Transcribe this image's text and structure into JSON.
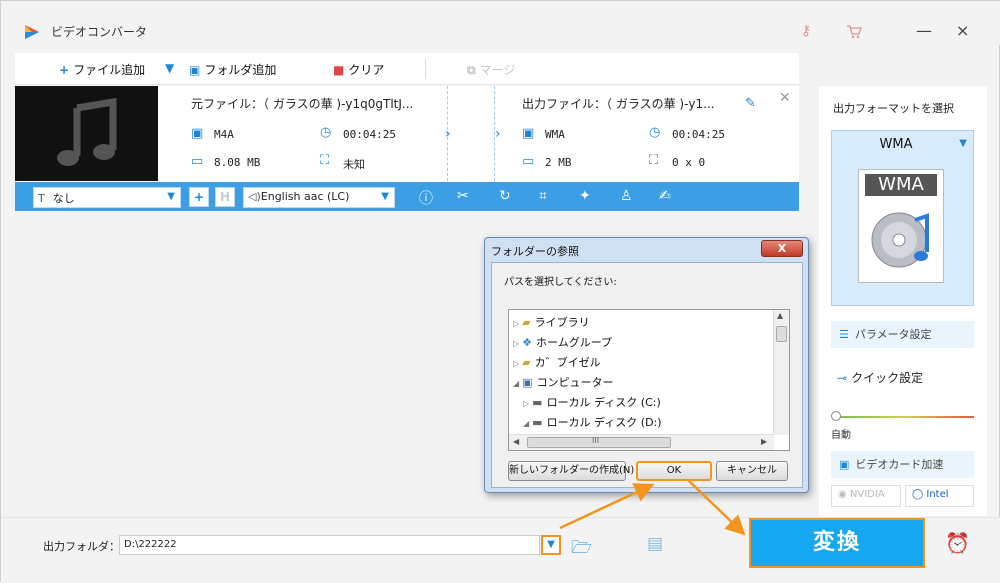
{
  "app": {
    "title": "ビデオコンバータ",
    "accent_color": "#1e86d8",
    "titlebar_icons": [
      "key-icon",
      "cart-icon"
    ],
    "window_controls": {
      "minimize": "—",
      "close": "×"
    }
  },
  "toolbar": {
    "add_file": "ファイル追加",
    "add_folder": "フォルダ追加",
    "clear": "クリア",
    "merge": "マージ"
  },
  "file": {
    "source_name": "元ファイル：（ ガラスの華 )-y1q0gTltJ...",
    "source_format": "M4A",
    "source_duration": "00:04:25",
    "source_size": "8.08 MB",
    "source_resolution": "未知",
    "output_name": "出力ファイル：（ ガラスの華 )-y1...",
    "output_format": "WMA",
    "output_duration": "00:04:25",
    "output_size": "2 MB",
    "output_resolution": "0 x 0"
  },
  "editbar": {
    "subtitle_value": "なし",
    "audio_track": "English aac (LC)",
    "tools": [
      "info-icon",
      "cut-icon",
      "rotate-icon",
      "crop-icon",
      "effect-icon",
      "watermark-icon",
      "subtitle-edit-icon"
    ]
  },
  "right_panel": {
    "title": "出力フォーマットを選択",
    "format": "WMA",
    "format_image_label": "WMA",
    "params": "パラメータ設定",
    "quick": "クイック設定",
    "auto": "自動",
    "gpu": "ビデオカード加速",
    "nvidia": "NVIDIA",
    "intel": "Intel"
  },
  "bottom": {
    "output_label": "出力フォルダ：",
    "output_path": "D:\\222222",
    "convert": "変換"
  },
  "dialog": {
    "title": "フォルダーの参照",
    "close": "X",
    "prompt": "パスを選択してください:",
    "tree": [
      {
        "label": "ライブラリ",
        "icon": "library-icon"
      },
      {
        "label": "ホームグループ",
        "icon": "homegroup-icon"
      },
      {
        "label": "カ゛ブイゼル",
        "icon": "user-folder-icon"
      },
      {
        "label": "コンピューター",
        "icon": "computer-icon"
      },
      {
        "label": "ローカル ディスク (C:)",
        "icon": "drive-icon"
      },
      {
        "label": "ローカル ディスク (D:)",
        "icon": "drive-icon"
      }
    ],
    "scroll_grip": "III",
    "new_folder": "新しいフォルダーの作成(N)",
    "ok": "OK",
    "cancel": "キャンセル",
    "highlight_color": "#f4941e"
  }
}
